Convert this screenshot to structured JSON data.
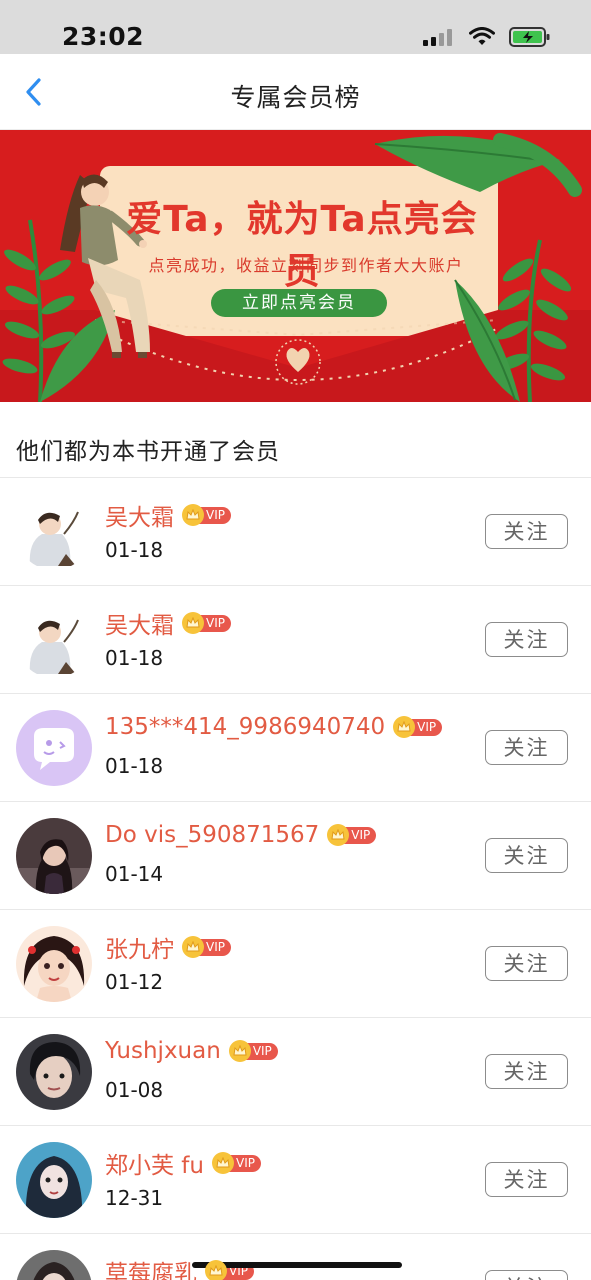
{
  "status_bar": {
    "time": "23:02"
  },
  "nav": {
    "title": "专属会员榜"
  },
  "banner": {
    "title": "爱Ta，就为Ta点亮会员",
    "subtitle": "点亮成功，收益立刻同步到作者大大账户",
    "button_label": "立即点亮会员",
    "colors": {
      "background": "#d71d1e",
      "card": "#fbe1c1",
      "button": "#3a9641"
    }
  },
  "section": {
    "title": "他们都为本书开通了会员"
  },
  "members": [
    {
      "name": "吴大霜",
      "date": "01-18",
      "vip": "VIP",
      "follow_label": "关注"
    },
    {
      "name": "吴大霜",
      "date": "01-18",
      "vip": "VIP",
      "follow_label": "关注"
    },
    {
      "name": "135***414_9986940740",
      "date": "01-18",
      "vip": "VIP",
      "follow_label": "关注"
    },
    {
      "name": "Do vis_590871567",
      "date": "01-14",
      "vip": "VIP",
      "follow_label": "关注"
    },
    {
      "name": "张九柠",
      "date": "01-12",
      "vip": "VIP",
      "follow_label": "关注"
    },
    {
      "name": "Yushjxuan",
      "date": "01-08",
      "vip": "VIP",
      "follow_label": "关注"
    },
    {
      "name": "郑小芙 fu",
      "date": "12-31",
      "vip": "VIP",
      "follow_label": "关注"
    },
    {
      "name": "草莓腐乳",
      "date": "",
      "vip": "VIP",
      "follow_label": "关注"
    }
  ],
  "colors": {
    "name": "#e25b43",
    "vip": "#e8574c",
    "crown": "#f7c33a",
    "back_arrow": "#2f8ef0"
  }
}
